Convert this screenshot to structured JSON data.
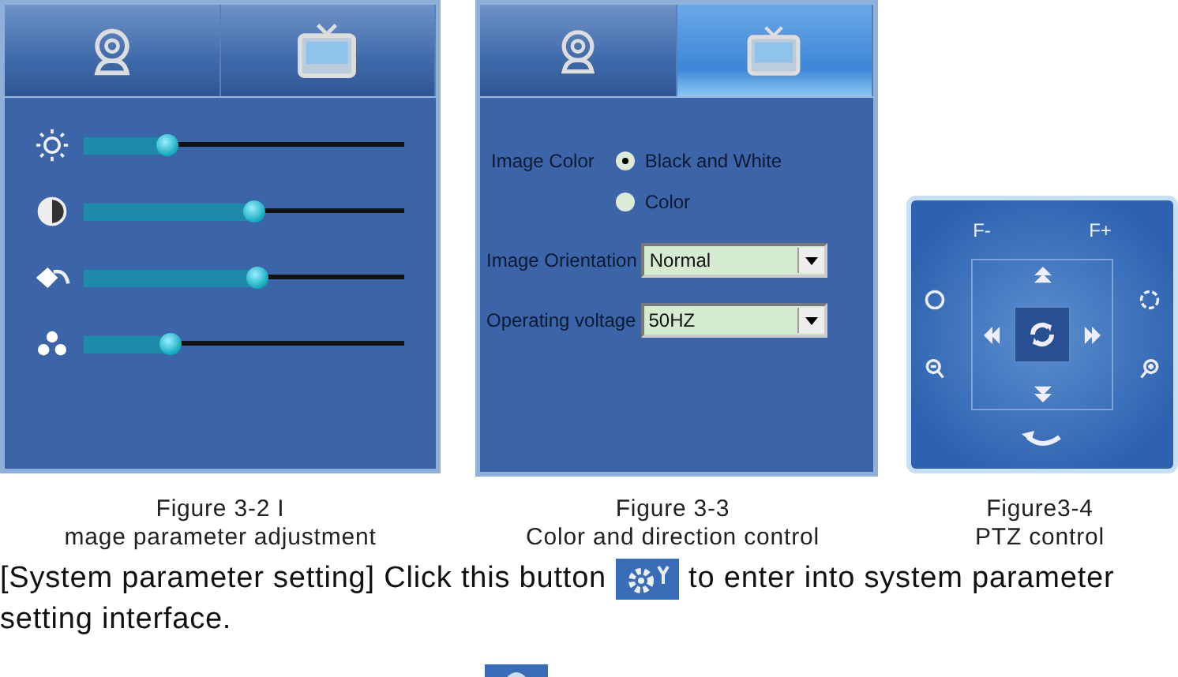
{
  "figure_image": {
    "tabs": [
      {
        "selected": false
      },
      {
        "selected": false
      }
    ],
    "sliders": [
      {
        "level": 0.26
      },
      {
        "level": 0.53
      },
      {
        "level": 0.54
      },
      {
        "level": 0.27
      }
    ]
  },
  "figure_color": {
    "tabs": [
      {
        "selected": false
      },
      {
        "selected": true
      }
    ],
    "image_color": {
      "label": "Image Color",
      "options": [
        {
          "label": "Black and White",
          "selected": true
        },
        {
          "label": "Color",
          "selected": false
        }
      ]
    },
    "dropdowns": [
      {
        "label": "Image Orientation",
        "value": "Normal"
      },
      {
        "label": "Operating voltage",
        "value": "50HZ"
      }
    ]
  },
  "figure_ptz": {
    "focus_buttons": [
      "F-",
      "F+"
    ]
  },
  "captions": [
    {
      "lines": [
        "Figure 3-2 I",
        "mage parameter adjustment"
      ]
    },
    {
      "lines": [
        "Figure 3-3",
        "Color and direction control"
      ]
    },
    {
      "lines": [
        "Figure3-4",
        "PTZ control"
      ]
    }
  ],
  "paragraph": {
    "before": "[System parameter setting] Click this button",
    "after": "to enter into system parameter",
    "continuation": "setting interface."
  }
}
